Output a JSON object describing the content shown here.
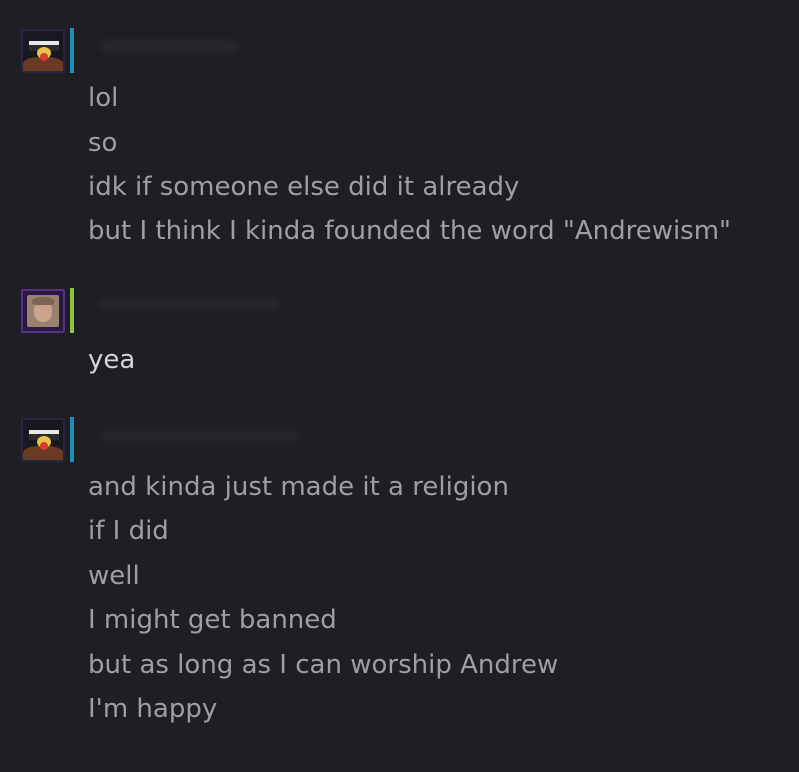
{
  "colors": {
    "background": "#1e1f23",
    "text": "#9d9fa2",
    "text_highlight": "#d4d5d7",
    "status_blue": "#1f8ebf",
    "status_green": "#8cc63f"
  },
  "messages": [
    {
      "avatar_icon": "user-avatar-flag-icon",
      "status_color": "#1f8ebf",
      "lines": [
        "lol",
        "so",
        "idk if someone else did it already",
        "but I think I kinda founded the word \"Andrewism\""
      ]
    },
    {
      "avatar_icon": "user-avatar-portrait-icon",
      "status_color": "#8cc63f",
      "lines": [
        "yea"
      ]
    },
    {
      "avatar_icon": "user-avatar-flag-icon",
      "status_color": "#1f8ebf",
      "lines": [
        "and kinda just made it a religion",
        "if I did",
        "well",
        "I might get banned",
        "but as long as I can worship Andrew",
        "I'm happy"
      ]
    }
  ]
}
